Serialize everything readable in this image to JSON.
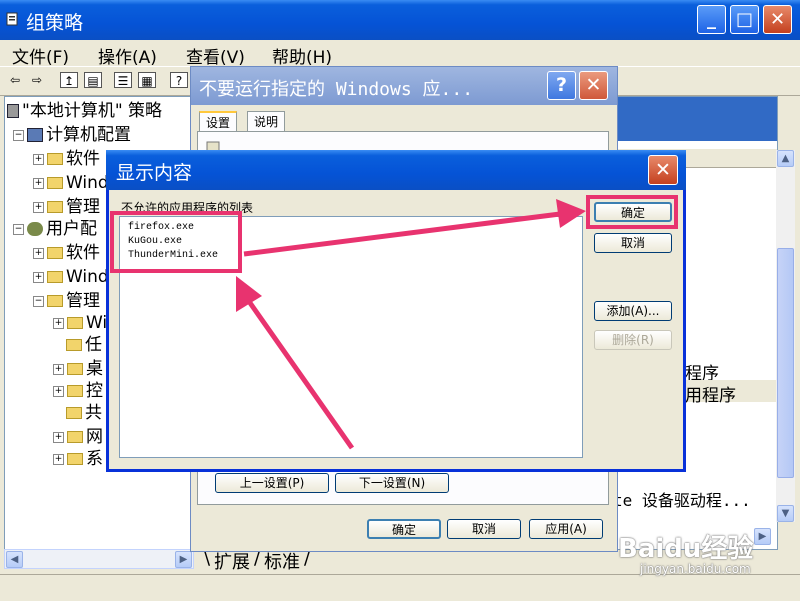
{
  "main_window": {
    "title": "组策略",
    "menu": [
      "文件(F)",
      "操作(A)",
      "查看(V)",
      "帮助(H)"
    ],
    "tree": [
      "\"本地计算机\" 策略",
      "计算机配置",
      "软件",
      "Wind",
      "管理",
      "用户配",
      "软件",
      "Wind",
      "管理",
      "Wi",
      "任",
      "桌",
      "控",
      "共",
      "网",
      "系"
    ],
    "right_pane": {
      "items": [
        "程序",
        "用程序",
        "te 设备驱动程..."
      ]
    },
    "bottom_tabs": [
      "扩展",
      "标准"
    ]
  },
  "properties_dialog": {
    "title": "不要运行指定的 Windows 应...",
    "tabs": [
      "设置",
      "说明"
    ],
    "prev_button": "上一设置(P)",
    "next_button": "下一设置(N)",
    "ok_button": "确定",
    "cancel_button": "取消",
    "apply_button": "应用(A)"
  },
  "show_contents_dialog": {
    "title": "显示内容",
    "list_label": "不允许的应用程序的列表",
    "items": [
      "firefox.exe",
      "KuGou.exe",
      "ThunderMini.exe"
    ],
    "ok_button": "确定",
    "cancel_button": "取消",
    "add_button": "添加(A)...",
    "delete_button": "删除(R)"
  },
  "watermark": {
    "brand": "Baidu经验",
    "url": "jingyan.baidu.com"
  },
  "colors": {
    "xp_title_blue": "#0553d6",
    "highlight_pink": "#e8336f",
    "dialog_face": "#ECE9D8"
  }
}
